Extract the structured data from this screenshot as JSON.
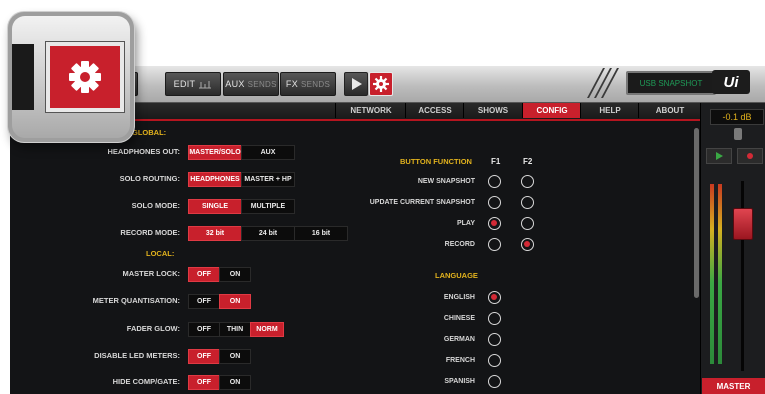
{
  "toolbar": {
    "edit_label": "EDIT",
    "aux_label": "AUX",
    "aux_sub": "SENDS",
    "fx_label": "FX",
    "fx_sub": "SENDS",
    "snapshot_text": "USB SNAPSHOT",
    "logo": "Ui"
  },
  "tabs": [
    {
      "label": "NETWORK"
    },
    {
      "label": "ACCESS"
    },
    {
      "label": "SHOWS"
    },
    {
      "label": "CONFIG",
      "active": true
    },
    {
      "label": "HELP"
    },
    {
      "label": "ABOUT"
    }
  ],
  "global": {
    "title": "GLOBAL:",
    "headphones_out": {
      "label": "HEADPHONES OUT:",
      "options": [
        "MASTER/SOLO",
        "AUX"
      ],
      "selected": "MASTER/SOLO"
    },
    "solo_routing": {
      "label": "SOLO ROUTING:",
      "options": [
        "HEADPHONES",
        "MASTER + HP"
      ],
      "selected": "HEADPHONES"
    },
    "solo_mode": {
      "label": "SOLO MODE:",
      "options": [
        "SINGLE",
        "MULTIPLE"
      ],
      "selected": "SINGLE"
    },
    "record_mode": {
      "label": "RECORD MODE:",
      "options": [
        "32 bit",
        "24 bit",
        "16 bit"
      ],
      "selected": "32 bit"
    }
  },
  "local": {
    "title": "LOCAL:",
    "master_lock": {
      "label": "MASTER LOCK:",
      "options": [
        "OFF",
        "ON"
      ],
      "selected": "OFF"
    },
    "meter_quantisation": {
      "label": "METER QUANTISATION:",
      "options": [
        "OFF",
        "ON"
      ],
      "selected": "ON"
    },
    "fader_glow": {
      "label": "FADER GLOW:",
      "options": [
        "OFF",
        "THIN",
        "NORM"
      ],
      "selected": "NORM"
    },
    "disable_led_meters": {
      "label": "DISABLE LED METERS:",
      "options": [
        "OFF",
        "ON"
      ],
      "selected": "OFF"
    },
    "hide_comp_gate": {
      "label": "HIDE COMP/GATE:",
      "options": [
        "OFF",
        "ON"
      ],
      "selected": "OFF"
    }
  },
  "button_function": {
    "title": "BUTTON FUNCTION",
    "columns": [
      "F1",
      "F2"
    ],
    "rows": [
      {
        "label": "NEW SNAPSHOT",
        "f1": false,
        "f2": false
      },
      {
        "label": "UPDATE CURRENT SNAPSHOT",
        "f1": false,
        "f2": false
      },
      {
        "label": "PLAY",
        "f1": true,
        "f2": false
      },
      {
        "label": "RECORD",
        "f1": false,
        "f2": true
      }
    ]
  },
  "language": {
    "title": "LANGUAGE",
    "options": [
      "ENGLISH",
      "CHINESE",
      "GERMAN",
      "FRENCH",
      "SPANISH"
    ],
    "selected": "ENGLISH"
  },
  "strip": {
    "level": "-0.1 dB",
    "master_label": "MASTER"
  },
  "colors": {
    "accent": "#c8202c",
    "section": "#e2b21d",
    "snapshot": "#1f9a57"
  }
}
